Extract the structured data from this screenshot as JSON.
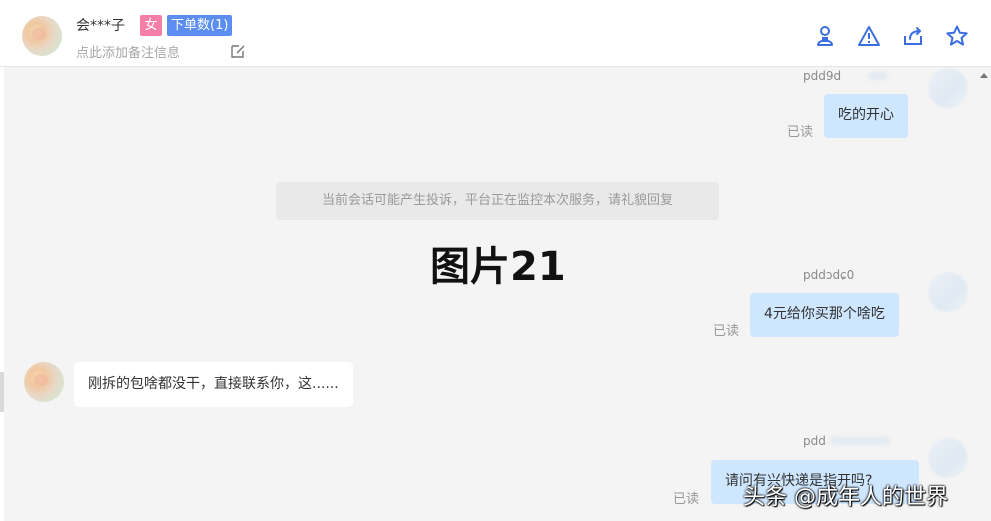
{
  "header": {
    "name": "会***子",
    "gender_badge": "女",
    "order_badge": "下单数(1)",
    "remark_placeholder": "点此添加备注信息",
    "icons": [
      "user-lock-icon",
      "warning-icon",
      "share-icon",
      "star-icon"
    ]
  },
  "colors": {
    "accent": "#3b6fe0",
    "gender_badge": "#f57fa6",
    "order_badge": "#5b8ef0",
    "bubble_out": "#cfe6ff",
    "chat_bg": "#f4f4f4"
  },
  "messages": [
    {
      "sender": "pdd9d",
      "text": "吃的开心",
      "status": "已读"
    },
    {
      "sender": "pddɔdɕ0",
      "text": "4元给你买那个啥吃",
      "status": "已读"
    },
    {
      "text": "刚拆的包啥都没干，直接联系你，这......"
    },
    {
      "sender": "pdd",
      "text": "请问有兴快递是指开吗?",
      "status": "已读"
    }
  ],
  "system_notice": "当前会话可能产生投诉，平台正在监控本次服务，请礼貌回复",
  "caption": "图片21",
  "watermark": "头条 @成年人的世界"
}
